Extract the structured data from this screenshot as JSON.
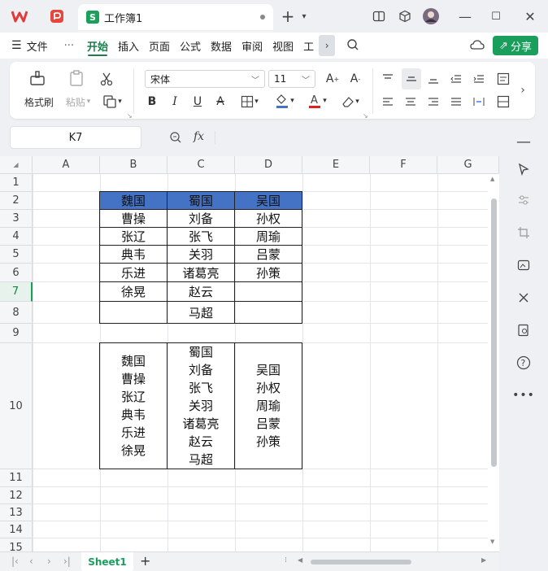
{
  "document": {
    "tab_title": "工作簿1"
  },
  "menu": {
    "file": "文件",
    "more": "···",
    "tabs": [
      "开始",
      "插入",
      "页面",
      "公式",
      "数据",
      "审阅",
      "视图",
      "工"
    ],
    "share": "分享"
  },
  "ribbon": {
    "format_painter": "格式刷",
    "paste": "粘贴",
    "font_name": "宋体",
    "font_size": "11",
    "bold": "B",
    "italic": "I",
    "underline": "U",
    "strike": "A",
    "font_color_bar": "#e02020",
    "fill_color_bar": "#4472c4"
  },
  "formula_bar": {
    "cell_ref": "K7",
    "fx": "fx",
    "value": ""
  },
  "grid": {
    "columns": [
      "A",
      "B",
      "C",
      "D",
      "E",
      "F",
      "G"
    ],
    "rows": [
      "1",
      "2",
      "3",
      "4",
      "5",
      "6",
      "7",
      "8",
      "9",
      "10",
      "11",
      "12",
      "13",
      "14",
      "15"
    ],
    "selected_row": "7",
    "header_fill": "#4472c4",
    "table": {
      "headers": [
        "魏国",
        "蜀国",
        "吴国"
      ],
      "body": [
        [
          "曹操",
          "刘备",
          "孙权"
        ],
        [
          "张辽",
          "张飞",
          "周瑜"
        ],
        [
          "典韦",
          "关羽",
          "吕蒙"
        ],
        [
          "乐进",
          "诸葛亮",
          "孙策"
        ],
        [
          "徐晃",
          "赵云",
          ""
        ],
        [
          "",
          "马超",
          ""
        ]
      ]
    },
    "merged": {
      "wei": [
        "魏国",
        "曹操",
        "张辽",
        "典韦",
        "乐进",
        "徐晃"
      ],
      "shu": [
        "蜀国",
        "刘备",
        "张飞",
        "关羽",
        "诸葛亮",
        "赵云",
        "马超"
      ],
      "wu": [
        "吴国",
        "孙权",
        "周瑜",
        "吕蒙",
        "孙策"
      ]
    }
  },
  "sheets": {
    "active": "Sheet1",
    "add": "+"
  }
}
